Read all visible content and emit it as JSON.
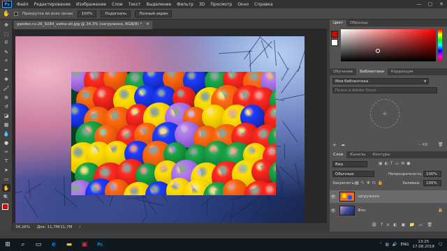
{
  "app": {
    "logo": "Ps"
  },
  "menu": [
    "Файл",
    "Редактирование",
    "Изображение",
    "Слои",
    "Текст",
    "Выделение",
    "Фильтр",
    "3D",
    "Просмотр",
    "Окно",
    "Справка"
  ],
  "window_buttons": [
    "—",
    "▢",
    "✕"
  ],
  "options": {
    "scroll_all": "Прокрутка во всех окнах",
    "zoom": "100%",
    "fit": "Подогнать",
    "fullscreen": "Полный экран"
  },
  "document": {
    "tab_title": "gaodex.ru-26_9284_vetka-eli.jpg @ 34,3% (загружено, RGB/8) *",
    "close": "✕"
  },
  "status": {
    "zoom": "34,26%",
    "doc": "Док: 11,7M/11,7M"
  },
  "tools": [
    "move-icon",
    "marquee-icon",
    "lasso-icon",
    "quick-select-icon",
    "crop-icon",
    "eyedropper-icon",
    "healing-icon",
    "brush-icon",
    "stamp-icon",
    "history-brush-icon",
    "eraser-icon",
    "gradient-icon",
    "blur-icon",
    "dodge-icon",
    "pen-icon",
    "type-icon",
    "path-select-icon",
    "shape-icon",
    "hand-icon",
    "zoom-icon"
  ],
  "tool_glyphs": [
    "✥",
    "⬚",
    "ᘓ",
    "✎",
    "⌗",
    "✒",
    "✚",
    "🖌",
    "⊕",
    "↺",
    "◪",
    "▦",
    "💧",
    "●",
    "✑",
    "T",
    "➤",
    "▭",
    "✋",
    "🔍"
  ],
  "color_panel": {
    "tabs": [
      "Цвет",
      "Образцы"
    ]
  },
  "library_panel": {
    "tabs": [
      "Обучение",
      "Библиотеки",
      "Коррекция"
    ],
    "library_name": "Моя библиотека",
    "search_placeholder": "Поиск в Adobe Stock",
    "size_label": "-- КБ"
  },
  "layers_panel": {
    "tabs": [
      "Слои",
      "Каналы",
      "Контуры"
    ],
    "filter": "Вид",
    "blend": "Обычные",
    "opacity_label": "Непрозрачность:",
    "opacity": "100%",
    "lock_label": "Закрепить:",
    "fill_label": "Заливка:",
    "fill": "100%",
    "layers": [
      {
        "name": "загружено"
      },
      {
        "name": "Фон"
      }
    ]
  },
  "taskbar": {
    "time": "13:25",
    "date": "17.08.2018",
    "lang": "ENG"
  }
}
